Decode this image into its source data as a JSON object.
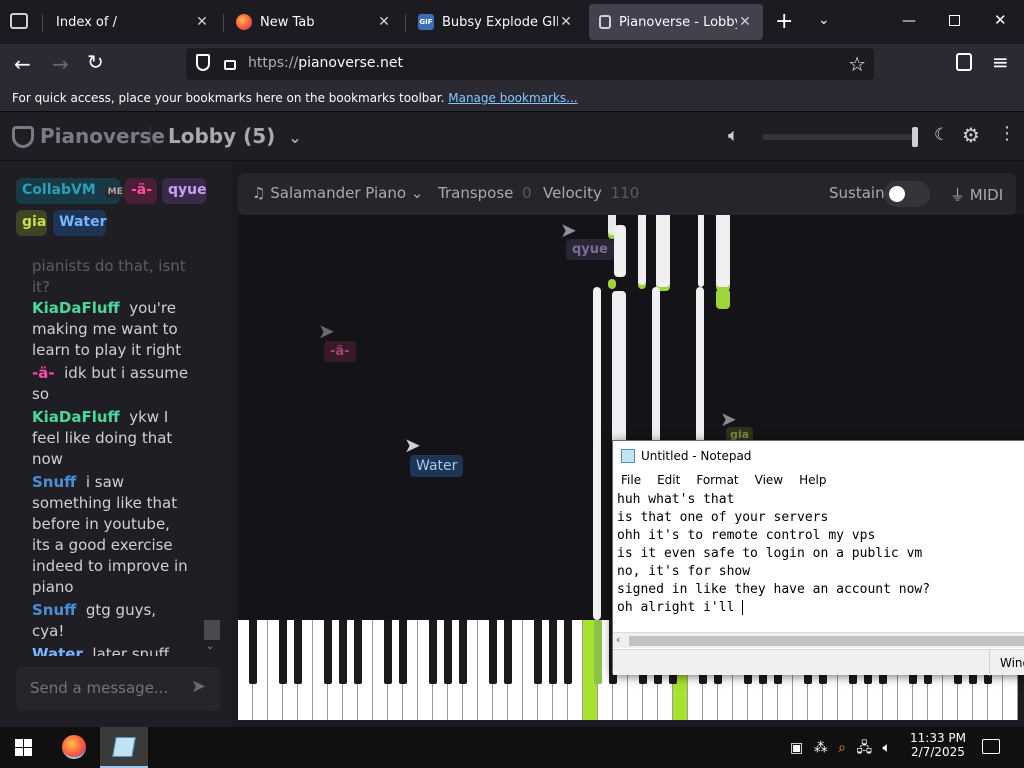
{
  "browser": {
    "tabs": [
      {
        "title": "Index of /",
        "active": false
      },
      {
        "title": "New Tab",
        "active": false
      },
      {
        "title": "Bubsy Explode GIF - Bu",
        "active": false
      },
      {
        "title": "Pianoverse - Lobby (5)",
        "active": true
      }
    ],
    "url_prefix": "https://",
    "url_host": "pianoverse.net",
    "bookmarks_hint": "For quick access, place your bookmarks here on the bookmarks toolbar.",
    "bookmarks_link": "Manage bookmarks..."
  },
  "app": {
    "brand": "Pianoverse",
    "room": "Lobby (5)",
    "volume_level": 1.0,
    "users": [
      {
        "name": "CollabVM",
        "badge": "ME",
        "color": "#2a9fb5",
        "bg": "#173a44"
      },
      {
        "name": "-ä-",
        "color": "#ff4da6",
        "bg": "#4a1f36"
      },
      {
        "name": "qyue",
        "color": "#c9a0f0",
        "bg": "#3a2a4a"
      },
      {
        "name": "gia",
        "color": "#c8e04a",
        "bg": "#3e4522"
      },
      {
        "name": "Water",
        "color": "#79b6ff",
        "bg": "#1e3455"
      }
    ],
    "chat": [
      {
        "user": "",
        "text": "pianists do that, isnt it?",
        "color": "#cfcfd4"
      },
      {
        "user": "KiaDaFluff",
        "text": "you're making me want to learn to play it right",
        "color": "#4ad99a"
      },
      {
        "user": "-ä-",
        "text": "idk but i assume so",
        "color": "#ff4da6"
      },
      {
        "user": "KiaDaFluff",
        "text": "ykw I feel like doing that now",
        "color": "#4ad99a"
      },
      {
        "user": "Snuff",
        "text": "i saw something like that before in youtube, its a good exercise indeed to improve in piano",
        "color": "#4a90d9"
      },
      {
        "user": "Snuff",
        "text": "gtg guys, cya!",
        "color": "#4a90d9"
      },
      {
        "user": "Water",
        "text": "later snuff",
        "color": "#79b6ff"
      }
    ],
    "message_placeholder": "Send a message...",
    "controls": {
      "instrument": "Salamander Piano",
      "transpose_label": "Transpose",
      "transpose_value": "0",
      "velocity_label": "Velocity",
      "velocity_value": "110",
      "sustain_label": "Sustain",
      "sustain_on": false,
      "midi_label": "MIDI"
    },
    "cursors": [
      {
        "name": "qyue",
        "color": "#c9a0f0",
        "bg": "#3a2a4a"
      },
      {
        "name": "-ä-",
        "color": "#ff4da6",
        "bg": "#4a1f36"
      },
      {
        "name": "Water",
        "color": "#79b6ff",
        "bg": "#1e3455"
      },
      {
        "name": "gia",
        "color": "#c8e04a",
        "bg": "#3e4522"
      }
    ]
  },
  "notepad": {
    "title": "Untitled - Notepad",
    "menu": [
      "File",
      "Edit",
      "Format",
      "View",
      "Help"
    ],
    "lines": [
      "huh what's that",
      "is that one of your servers",
      "ohh it's to remote control my vps",
      "is it even safe to login on a public vm",
      "no, it's for show",
      "signed in like they have an account now?",
      "oh alright i'll "
    ],
    "status_partial": "Wind"
  },
  "taskbar": {
    "time": "11:33 PM",
    "date": "2/7/2025"
  }
}
